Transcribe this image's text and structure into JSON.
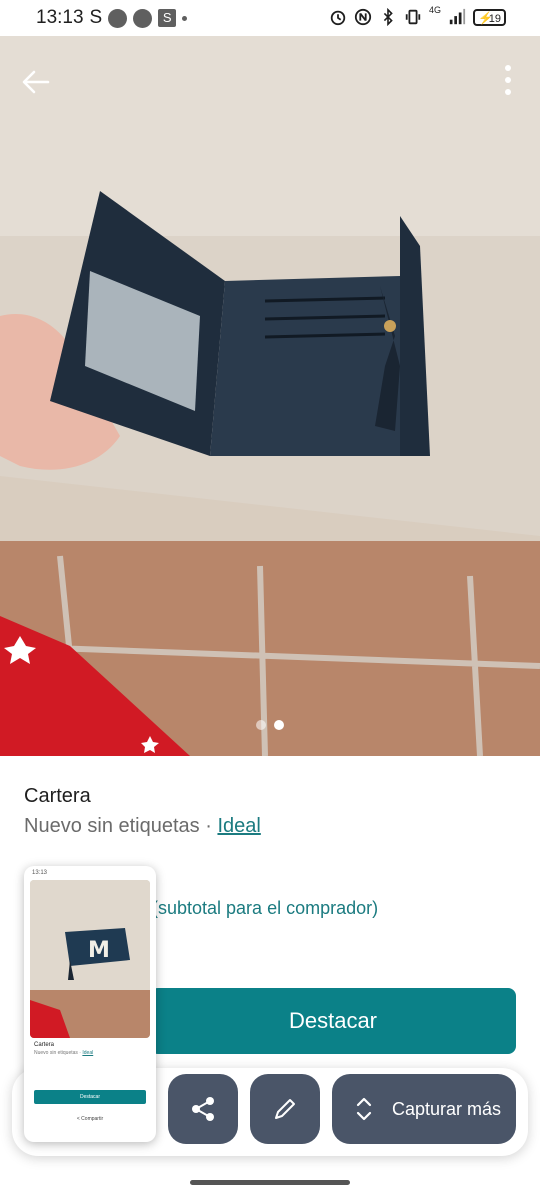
{
  "status_bar": {
    "time": "13:13",
    "carrier_glyph": "S",
    "app_badge": "S",
    "network": "4G",
    "battery": "19",
    "icons": [
      "alarm-icon",
      "nfc-icon",
      "bluetooth-icon",
      "vibrate-icon",
      "signal-icon",
      "battery-icon"
    ]
  },
  "photo": {
    "pager": {
      "count": 2,
      "active_index": 1
    },
    "icons": [
      "back-arrow-icon",
      "more-vertical-icon"
    ]
  },
  "product": {
    "title": "Cartera",
    "condition": "Nuevo sin etiquetas",
    "separator": " · ",
    "condition_link": "Ideal",
    "price_note": "(subtotal para el comprador)",
    "promote_label": "Destacar"
  },
  "share_sheet": {
    "capture_more_label": "Capturar más",
    "icons": [
      "share-icon",
      "edit-icon",
      "expand-icon"
    ]
  },
  "thumbnail": {
    "status_time": "13:13",
    "title": "Cartera",
    "condition": "Nuevo sin etiquetas",
    "condition_link": "Ideal",
    "promote_label": "Destacar",
    "share_label": "Compartir"
  },
  "colors": {
    "accent": "#0b8188",
    "link": "#1b7b80",
    "action_button": "#4a5568"
  }
}
